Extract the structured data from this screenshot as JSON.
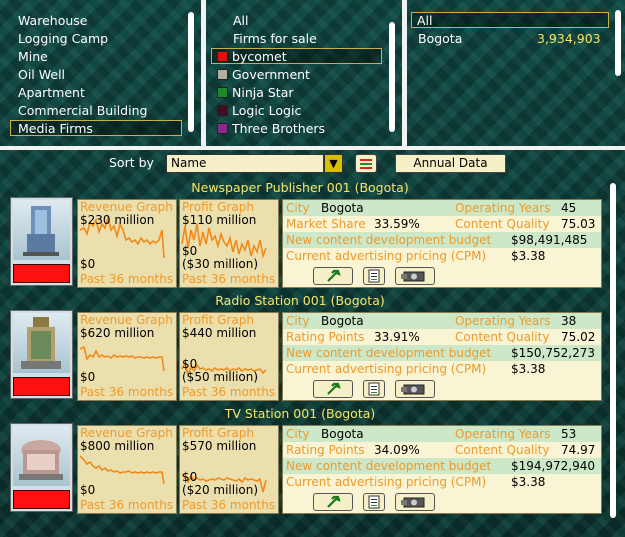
{
  "categories": {
    "items": [
      "Warehouse",
      "Logging Camp",
      "Mine",
      "Oil Well",
      "Apartment",
      "Commercial Building",
      "Media Firms"
    ],
    "selected": "Media Firms"
  },
  "owners": {
    "items": [
      {
        "label": "All",
        "color": ""
      },
      {
        "label": "Firms for sale",
        "color": ""
      },
      {
        "label": "bycomet",
        "color": "#e01010"
      },
      {
        "label": "Government",
        "color": "#b0b0a0"
      },
      {
        "label": "Ninja Star",
        "color": "#1c8a2a"
      },
      {
        "label": "Logic Logic",
        "color": "#401020"
      },
      {
        "label": "Three Brothers",
        "color": "#8a2a8a"
      }
    ],
    "selected": "bycomet"
  },
  "cities": {
    "all_label": "All",
    "items": [
      {
        "name": "Bogota",
        "value": "3,934,903"
      }
    ]
  },
  "sort": {
    "label": "Sort by",
    "value": "Name",
    "annual_button": "Annual Data"
  },
  "firms": [
    {
      "title": "Newspaper Publisher 001 (Bogota)",
      "revenue_label": "Revenue Graph",
      "revenue_value": "$230 million",
      "revenue_zero": "$0",
      "profit_label": "Profit Graph",
      "profit_value": "$110 million",
      "profit_zero": "$0",
      "profit_min": "($30 million)",
      "period": "Past 36 months",
      "city_label": "City",
      "city": "Bogota",
      "years_label": "Operating Years",
      "years": "45",
      "metric_label": "Market Share",
      "metric": "33.59%",
      "quality_label": "Content Quality",
      "quality": "75.03",
      "budget_label": "New content development budget",
      "budget": "$98,491,485",
      "pricing_label": "Current advertising pricing (CPM)",
      "pricing": "$3.38"
    },
    {
      "title": "Radio Station 001 (Bogota)",
      "revenue_label": "Revenue Graph",
      "revenue_value": "$620 million",
      "revenue_zero": "$0",
      "profit_label": "Profit Graph",
      "profit_value": "$440 million",
      "profit_zero": "$0",
      "profit_min": "($50 million)",
      "period": "Past 36 months",
      "city_label": "City",
      "city": "Bogota",
      "years_label": "Operating Years",
      "years": "38",
      "metric_label": "Rating Points",
      "metric": "33.91%",
      "quality_label": "Content Quality",
      "quality": "75.02",
      "budget_label": "New content development budget",
      "budget": "$150,752,273",
      "pricing_label": "Current advertising pricing (CPM)",
      "pricing": "$3.38"
    },
    {
      "title": "TV Station 001 (Bogota)",
      "revenue_label": "Revenue Graph",
      "revenue_value": "$800 million",
      "revenue_zero": "$0",
      "profit_label": "Profit Graph",
      "profit_value": "$570 million",
      "profit_zero": "$0",
      "profit_min": "($20 million)",
      "period": "Past 36 months",
      "city_label": "City",
      "city": "Bogota",
      "years_label": "Operating Years",
      "years": "53",
      "metric_label": "Rating Points",
      "metric": "34.09%",
      "quality_label": "Content Quality",
      "quality": "74.97",
      "budget_label": "New content development budget",
      "budget": "$194,972,940",
      "pricing_label": "Current advertising pricing (CPM)",
      "pricing": "$3.38"
    }
  ],
  "colors": {
    "accent_yellow": "#f5e66a",
    "label_orange": "#ee9a2a",
    "panel_bg": "#0d3a36"
  }
}
